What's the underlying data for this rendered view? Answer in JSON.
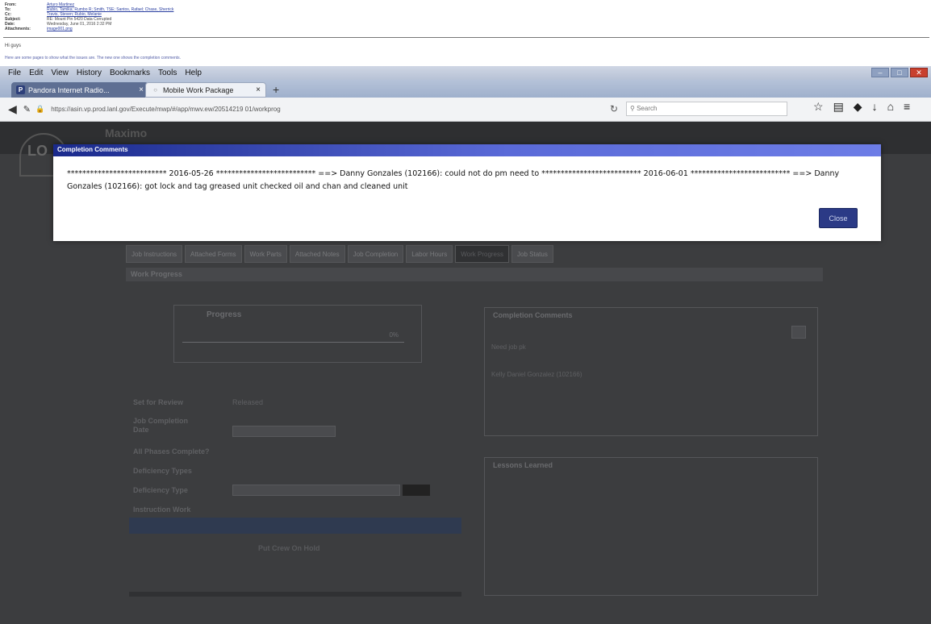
{
  "email": {
    "rows": [
      {
        "label": "From:",
        "value": "Arturo Martinez",
        "link": true
      },
      {
        "label": "To:",
        "value": "Rubio, Tamika; Rumbo R; Smith, TSE; Santos, Rafael; Chase, Sherrick",
        "link": true
      },
      {
        "label": "Cc:",
        "value": "Travis, Steven; Rubio, Melanie",
        "link": true
      },
      {
        "label": "Subject:",
        "value": "RE: Mount Pin 5420 Data Corrupted",
        "link": false
      },
      {
        "label": "Date:",
        "value": "Wednesday, June 01, 2016 2:32 PM",
        "link": false
      },
      {
        "label": "Attachments:",
        "value": "image001.png",
        "link": true
      }
    ],
    "greeting": "Hi guys",
    "note": "Here are some pages to show what the issues are. The new one shows the completion comments."
  },
  "browser": {
    "menu": [
      "File",
      "Edit",
      "View",
      "History",
      "Bookmarks",
      "Tools",
      "Help"
    ],
    "tabs": [
      {
        "label": "Pandora Internet Radio...",
        "icon": "P"
      },
      {
        "label": "Mobile Work Package",
        "icon": "○"
      }
    ],
    "url": "https://asin.vp.prod.lanl.gov/Execute/mwp/#/app/mwv.ew/20514219 01/workprog",
    "search_placeholder": "Search"
  },
  "app": {
    "brand": "Maximo",
    "tabs": [
      "Job Instructions",
      "Attached Forms",
      "Work Parts",
      "Attached Notes",
      "Job Completion",
      "Labor Hours",
      "Work Progress",
      "Job Status"
    ],
    "active_tab_index": 6,
    "section_title": "Work Progress",
    "progress": {
      "title": "Progress",
      "percent": "0%"
    },
    "form": {
      "status_label": "Set for Review",
      "status_value": "Released",
      "completion_label": "Job Completion Date",
      "percent_complete_label": "All Phases Complete?",
      "deficiency_label": "Deficiency Types",
      "deficiency2_label": "Deficiency Type",
      "instruction_label": "Instruction Work",
      "hold_text": "Put Crew On Hold"
    },
    "completion_panel": {
      "title": "Completion Comments",
      "line1": "Need job pk",
      "line2": "Kelly Daniel Gonzalez (102166)"
    },
    "lessons_panel": {
      "title": "Lessons Learned"
    }
  },
  "modal": {
    "title": "Completion Comments",
    "text": "************************** 2016-05-26 ************************** ==> Danny Gonzales (102166): could not do pm need to ************************** 2016-06-01 ************************** ==> Danny Gonzales (102166): got lock and tag greased unit checked oil and chan and cleaned unit",
    "close_label": "Close"
  },
  "colors": {
    "modal_title_start": "#1a2a8c",
    "modal_title_end": "#6d7de6",
    "close_button": "#2b3a86",
    "overlay": "#3c3d3f"
  }
}
